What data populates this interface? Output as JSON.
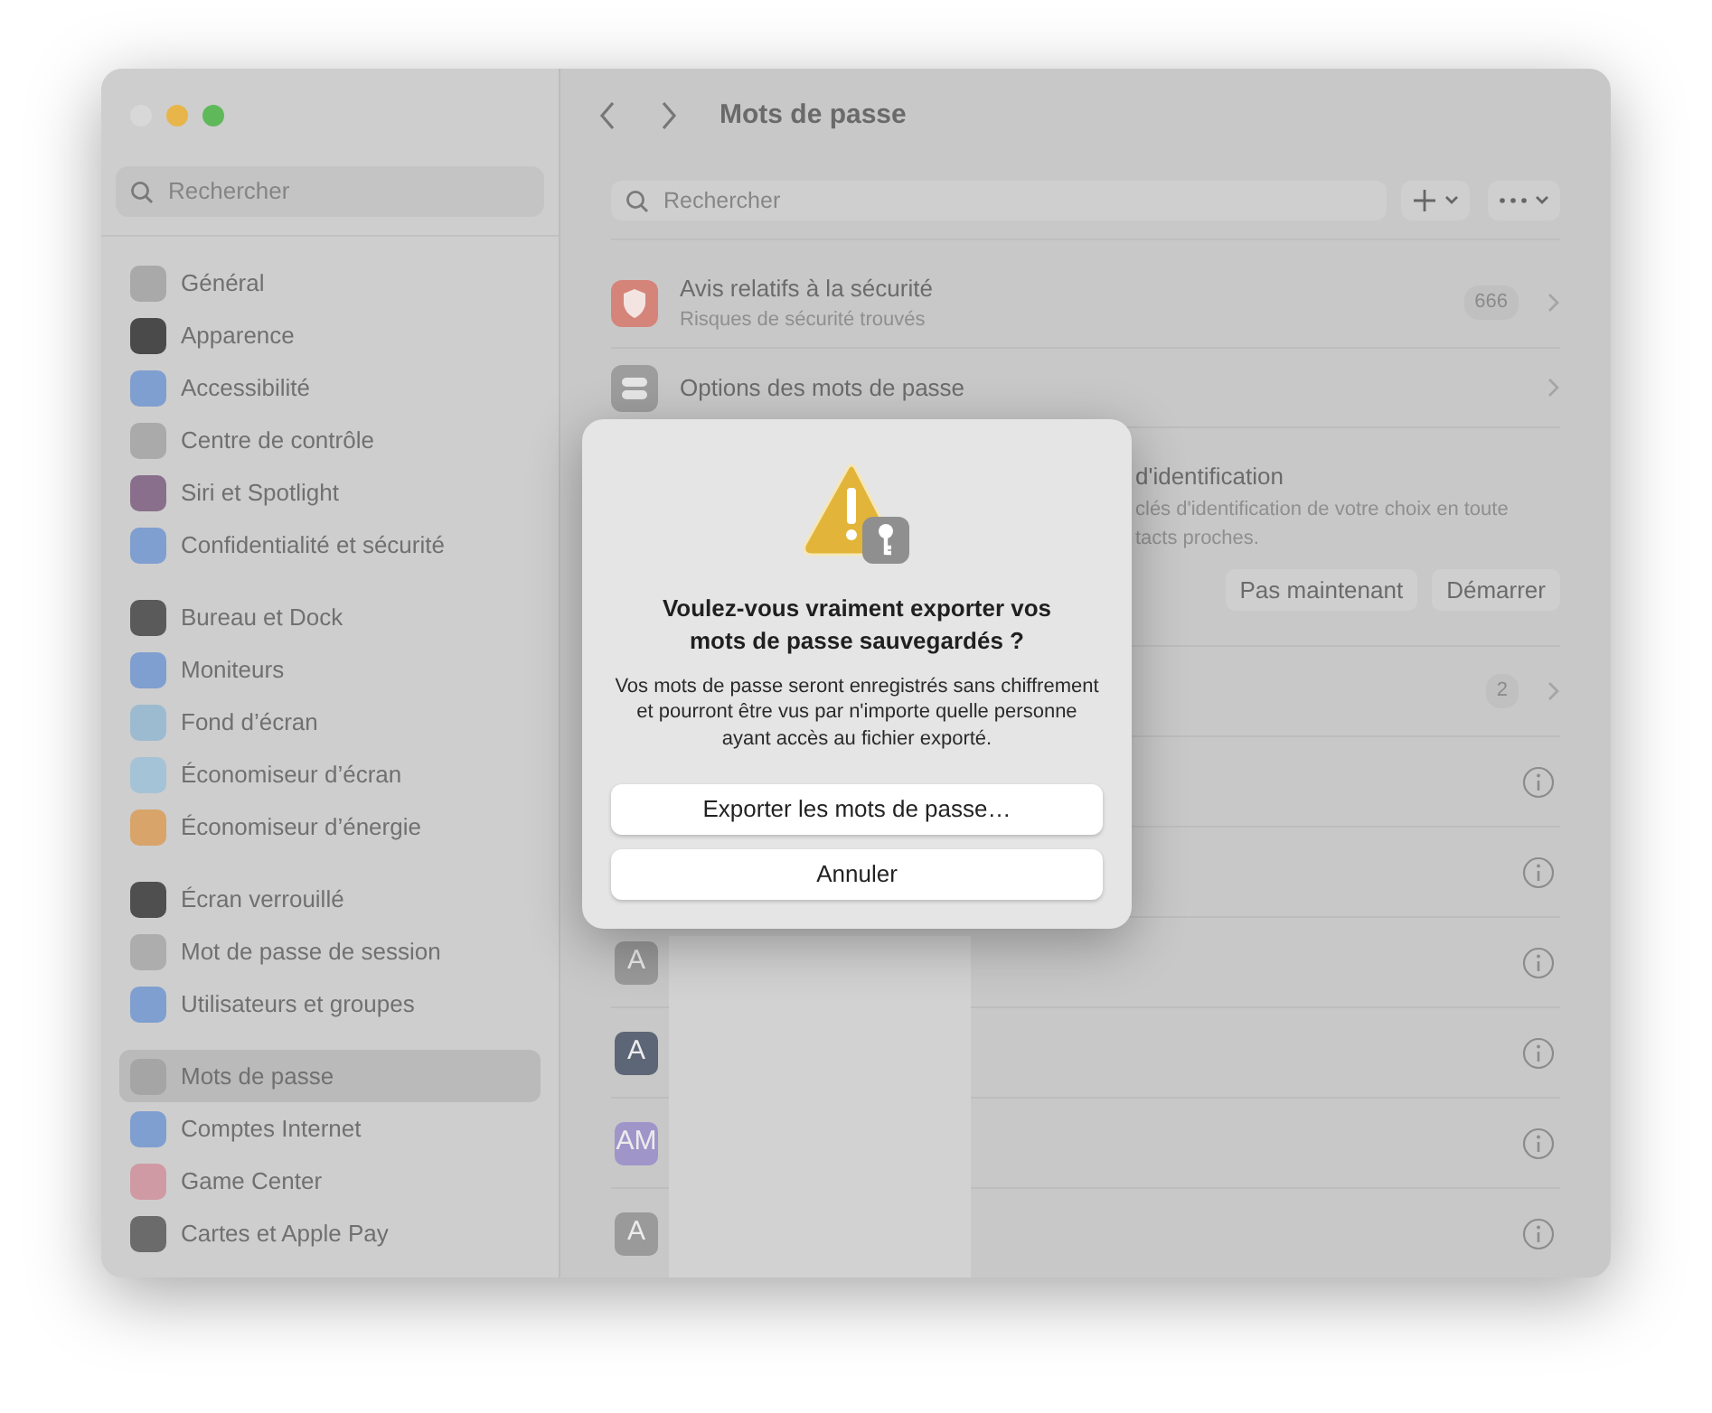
{
  "sidebar": {
    "search": {
      "placeholder": "Rechercher"
    },
    "groups": [
      {
        "items": [
          {
            "label": "Général",
            "selected": false
          },
          {
            "label": "Apparence",
            "selected": false
          },
          {
            "label": "Accessibilité",
            "selected": false
          },
          {
            "label": "Centre de contrôle",
            "selected": false
          },
          {
            "label": "Siri et Spotlight",
            "selected": false
          },
          {
            "label": "Confidentialité et sécurité",
            "selected": false
          }
        ]
      },
      {
        "items": [
          {
            "label": "Bureau et Dock",
            "selected": false
          },
          {
            "label": "Moniteurs",
            "selected": false
          },
          {
            "label": "Fond d’écran",
            "selected": false
          },
          {
            "label": "Économiseur d’écran",
            "selected": false
          },
          {
            "label": "Économiseur d’énergie",
            "selected": false
          }
        ]
      },
      {
        "items": [
          {
            "label": "Écran verrouillé",
            "selected": false
          },
          {
            "label": "Mot de passe de session",
            "selected": false
          },
          {
            "label": "Utilisateurs et groupes",
            "selected": false
          }
        ]
      },
      {
        "items": [
          {
            "label": "Mots de passe",
            "selected": true
          },
          {
            "label": "Comptes Internet",
            "selected": false
          },
          {
            "label": "Game Center",
            "selected": false
          },
          {
            "label": "Cartes et Apple Pay",
            "selected": false
          }
        ]
      }
    ]
  },
  "main": {
    "title": "Mots de passe",
    "search": {
      "placeholder": "Rechercher"
    },
    "rows": [
      {
        "kind": "security",
        "title": "Avis relatifs à la sécurité",
        "subtitle": "Risques de sécurité trouvés",
        "count": "666"
      },
      {
        "kind": "options",
        "title": "Options des mots de passe"
      },
      {
        "kind": "suggestion",
        "title": "d'identification",
        "lines": [
          "clés d'identification de votre choix en toute",
          "tacts proches."
        ],
        "buttons": [
          "Pas maintenant",
          "Démarrer"
        ]
      },
      {
        "kind": "group",
        "count": "2"
      },
      {
        "kind": "password"
      },
      {
        "kind": "password"
      },
      {
        "kind": "password",
        "avatar": "A",
        "color": "#9a9a9a"
      },
      {
        "kind": "password",
        "avatar": "A",
        "color": "#5d6676"
      },
      {
        "kind": "password",
        "avatar": "AM",
        "color": "#9f95c9"
      },
      {
        "kind": "password",
        "avatar": "A",
        "color": "#9a9a9a"
      }
    ]
  },
  "dialog": {
    "title": "Voulez-vous vraiment exporter vos mots de passe sauvegardés ?",
    "message": "Vos mots de passe seront enregistrés sans chiffrement et pourront être vus par n'importe quelle personne ayant accès au fichier exporté.",
    "buttons": [
      "Exporter les mots de passe…",
      "Annuler"
    ]
  }
}
